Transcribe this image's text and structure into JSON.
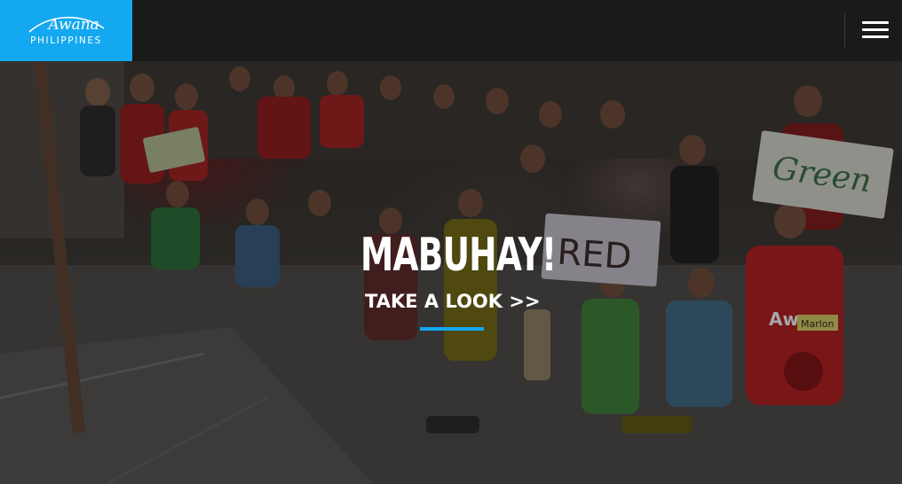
{
  "header": {
    "logo": {
      "wordmark": "Awana",
      "subtitle": "PHILIPPINES",
      "background_color": "#14a8f0"
    },
    "menu_icon": "hamburger-menu-icon"
  },
  "hero": {
    "headline": "MABUHAY!",
    "cta_label": "TAKE A LOOK >>",
    "accent_color": "#14a8f0",
    "photo_signs": [
      "Green",
      "RED",
      "Awana",
      "Marlon"
    ]
  }
}
